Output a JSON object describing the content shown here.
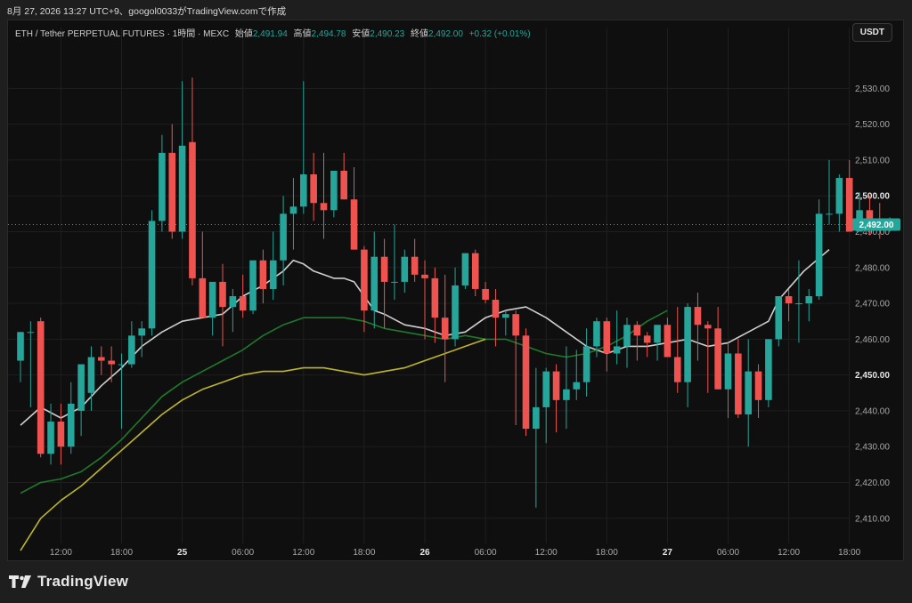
{
  "caption": "8月 27, 2026 13:27 UTC+9、googol0033がTradingView.comで作成",
  "legend": {
    "symbol": "ETH / Tether PERPETUAL FUTURES · 1時間 · MEXC",
    "open_label": "始値",
    "open": "2,491.94",
    "high_label": "高値",
    "high": "2,494.78",
    "low_label": "安値",
    "low": "2,490.23",
    "close_label": "終値",
    "close": "2,492.00",
    "change": "+0.32 (+0.01%)"
  },
  "unit_badge": "USDT",
  "footer": {
    "brand": "TradingView"
  },
  "colors": {
    "up": "#26a69a",
    "down": "#ef5350",
    "ma_fast": "#cfcfcf",
    "ma_mid": "#1e7a2a",
    "ma_slow": "#bdb52a",
    "grid": "#1f1f1f",
    "axis_text": "#a8a8a8",
    "price_badge_bg": "#26a69a",
    "price_badge_text": "#ffffff"
  },
  "chart_data": {
    "type": "candlestick",
    "interval": "1h",
    "y_range": [
      2403,
      2542
    ],
    "y_ticks": [
      {
        "value": 2410,
        "label": "2,410.00"
      },
      {
        "value": 2420,
        "label": "2,420.00"
      },
      {
        "value": 2430,
        "label": "2,430.00"
      },
      {
        "value": 2440,
        "label": "2,440.00"
      },
      {
        "value": 2450,
        "label": "2,450.00"
      },
      {
        "value": 2460,
        "label": "2,460.00"
      },
      {
        "value": 2470,
        "label": "2,470.00"
      },
      {
        "value": 2480,
        "label": "2,480.00"
      },
      {
        "value": 2490,
        "label": "2,490.00"
      },
      {
        "value": 2500,
        "label": "2,500.00"
      },
      {
        "value": 2510,
        "label": "2,510.00"
      },
      {
        "value": 2520,
        "label": "2,520.00"
      },
      {
        "value": 2530,
        "label": "2,530.00"
      }
    ],
    "bold_y_ticks": [
      2450,
      2500
    ],
    "x_ticks": [
      {
        "index": 4,
        "label": "12:00",
        "bold": false
      },
      {
        "index": 10,
        "label": "18:00",
        "bold": false
      },
      {
        "index": 16,
        "label": "25",
        "bold": true
      },
      {
        "index": 22,
        "label": "06:00",
        "bold": false
      },
      {
        "index": 28,
        "label": "12:00",
        "bold": false
      },
      {
        "index": 34,
        "label": "18:00",
        "bold": false
      },
      {
        "index": 40,
        "label": "26",
        "bold": true
      },
      {
        "index": 46,
        "label": "06:00",
        "bold": false
      },
      {
        "index": 52,
        "label": "12:00",
        "bold": false
      },
      {
        "index": 58,
        "label": "18:00",
        "bold": false
      },
      {
        "index": 64,
        "label": "27",
        "bold": true
      },
      {
        "index": 70,
        "label": "06:00",
        "bold": false
      },
      {
        "index": 76,
        "label": "12:00",
        "bold": false
      },
      {
        "index": 82,
        "label": "18:00",
        "bold": false
      }
    ],
    "last_price": {
      "value": 2492.0,
      "label": "2,492.00"
    },
    "candles": [
      [
        2454,
        2462,
        2448,
        2462
      ],
      [
        2462,
        2465,
        2441,
        2462
      ],
      [
        2465,
        2466,
        2427,
        2428
      ],
      [
        2428,
        2442,
        2425,
        2437
      ],
      [
        2437,
        2442,
        2425,
        2430
      ],
      [
        2430,
        2448,
        2428,
        2442
      ],
      [
        2440,
        2450,
        2433,
        2453
      ],
      [
        2445,
        2458,
        2440,
        2455
      ],
      [
        2455,
        2458,
        2450,
        2454
      ],
      [
        2454,
        2458,
        2448,
        2453
      ],
      [
        2453,
        2456,
        2435,
        2453
      ],
      [
        2453,
        2465,
        2452,
        2461
      ],
      [
        2461,
        2465,
        2455,
        2463
      ],
      [
        2463,
        2496,
        2461,
        2493
      ],
      [
        2493,
        2517,
        2490,
        2512
      ],
      [
        2512,
        2520,
        2488,
        2490
      ],
      [
        2490,
        2532,
        2488,
        2514
      ],
      [
        2515,
        2533,
        2475,
        2477
      ],
      [
        2477,
        2490,
        2475,
        2466
      ],
      [
        2466,
        2475,
        2461,
        2476
      ],
      [
        2476,
        2481,
        2458,
        2469
      ],
      [
        2469,
        2474,
        2462,
        2472
      ],
      [
        2472,
        2478,
        2466,
        2468
      ],
      [
        2468,
        2480,
        2467,
        2482
      ],
      [
        2482,
        2485,
        2470,
        2474
      ],
      [
        2474,
        2490,
        2471,
        2482
      ],
      [
        2482,
        2500,
        2475,
        2495
      ],
      [
        2495,
        2505,
        2485,
        2497
      ],
      [
        2497,
        2532,
        2495,
        2506
      ],
      [
        2506,
        2512,
        2493,
        2498
      ],
      [
        2498,
        2512,
        2488,
        2496
      ],
      [
        2496,
        2507,
        2494,
        2507
      ],
      [
        2507,
        2512,
        2499,
        2499
      ],
      [
        2499,
        2508,
        2485,
        2485
      ],
      [
        2485,
        2486,
        2462,
        2468
      ],
      [
        2468,
        2490,
        2463,
        2483
      ],
      [
        2483,
        2488,
        2463,
        2476
      ],
      [
        2476,
        2492,
        2471,
        2476
      ],
      [
        2476,
        2485,
        2473,
        2483
      ],
      [
        2483,
        2488,
        2476,
        2478
      ],
      [
        2478,
        2482,
        2460,
        2477
      ],
      [
        2477,
        2480,
        2459,
        2466
      ],
      [
        2466,
        2478,
        2448,
        2460
      ],
      [
        2460,
        2480,
        2458,
        2475
      ],
      [
        2475,
        2484,
        2474,
        2484
      ],
      [
        2484,
        2485,
        2472,
        2474
      ],
      [
        2474,
        2476,
        2470,
        2471
      ],
      [
        2471,
        2474,
        2458,
        2466
      ],
      [
        2466,
        2468,
        2461,
        2467
      ],
      [
        2467,
        2468,
        2436,
        2461
      ],
      [
        2461,
        2463,
        2433,
        2435
      ],
      [
        2435,
        2452,
        2413,
        2441
      ],
      [
        2441,
        2452,
        2431,
        2451
      ],
      [
        2451,
        2453,
        2434,
        2443
      ],
      [
        2443,
        2458,
        2435,
        2446
      ],
      [
        2446,
        2457,
        2443,
        2448
      ],
      [
        2448,
        2463,
        2444,
        2458
      ],
      [
        2458,
        2466,
        2455,
        2465
      ],
      [
        2465,
        2466,
        2451,
        2456
      ],
      [
        2456,
        2468,
        2453,
        2458
      ],
      [
        2458,
        2466,
        2452,
        2464
      ],
      [
        2464,
        2465,
        2454,
        2461
      ],
      [
        2461,
        2462,
        2455,
        2459
      ],
      [
        2459,
        2462,
        2454,
        2464
      ],
      [
        2464,
        2466,
        2455,
        2455
      ],
      [
        2455,
        2469,
        2445,
        2448
      ],
      [
        2448,
        2470,
        2441,
        2469
      ],
      [
        2469,
        2473,
        2454,
        2464
      ],
      [
        2464,
        2465,
        2445,
        2463
      ],
      [
        2463,
        2469,
        2446,
        2446
      ],
      [
        2446,
        2459,
        2438,
        2456
      ],
      [
        2456,
        2460,
        2438,
        2439
      ],
      [
        2439,
        2460,
        2430,
        2451
      ],
      [
        2451,
        2453,
        2438,
        2443
      ],
      [
        2443,
        2460,
        2441,
        2460
      ],
      [
        2460,
        2472,
        2458,
        2472
      ],
      [
        2472,
        2474,
        2465,
        2470
      ],
      [
        2470,
        2482,
        2459,
        2470
      ],
      [
        2470,
        2474,
        2465,
        2472
      ],
      [
        2472,
        2499,
        2471,
        2495
      ],
      [
        2495,
        2510,
        2492,
        2495
      ],
      [
        2495,
        2506,
        2490,
        2505
      ],
      [
        2505,
        2510,
        2494,
        2490
      ],
      [
        2490,
        2501,
        2492,
        2496
      ],
      [
        2496,
        2500,
        2489,
        2493
      ],
      [
        2493,
        2498,
        2488,
        2491
      ],
      [
        2491,
        2494,
        2490,
        2492
      ]
    ],
    "series": [
      {
        "name": "",
        "color_key": "ma_fast",
        "points": [
          [
            0,
            2436
          ],
          [
            4,
            2441
          ],
          [
            8,
            2438
          ],
          [
            12,
            2441
          ],
          [
            16,
            2447
          ],
          [
            20,
            2452
          ],
          [
            24,
            2458
          ],
          [
            28,
            2462
          ],
          [
            32,
            2465
          ],
          [
            36,
            2466
          ],
          [
            40,
            2467
          ],
          [
            44,
            2472
          ],
          [
            48,
            2475
          ],
          [
            52,
            2479
          ],
          [
            54,
            2482
          ],
          [
            56,
            2481
          ],
          [
            58,
            2479
          ],
          [
            60,
            2478
          ],
          [
            62,
            2477
          ],
          [
            64,
            2477
          ],
          [
            66,
            2476
          ],
          [
            68,
            2472
          ],
          [
            70,
            2468
          ],
          [
            72,
            2467
          ],
          [
            76,
            2464
          ],
          [
            80,
            2463
          ],
          [
            84,
            2461
          ],
          [
            88,
            2462
          ],
          [
            92,
            2466
          ],
          [
            96,
            2468
          ],
          [
            100,
            2469
          ],
          [
            104,
            2466
          ],
          [
            108,
            2462
          ],
          [
            112,
            2458
          ],
          [
            116,
            2456
          ],
          [
            120,
            2458
          ],
          [
            124,
            2458
          ],
          [
            128,
            2459
          ],
          [
            132,
            2460
          ],
          [
            136,
            2458
          ],
          [
            140,
            2459
          ],
          [
            144,
            2462
          ],
          [
            148,
            2465
          ],
          [
            150,
            2471
          ],
          [
            155,
            2479
          ],
          [
            160,
            2485
          ]
        ]
      },
      {
        "name": "",
        "color_key": "ma_mid",
        "points": [
          [
            0,
            2417
          ],
          [
            4,
            2420
          ],
          [
            8,
            2421
          ],
          [
            12,
            2423
          ],
          [
            16,
            2427
          ],
          [
            20,
            2432
          ],
          [
            24,
            2438
          ],
          [
            28,
            2444
          ],
          [
            32,
            2448
          ],
          [
            36,
            2451
          ],
          [
            40,
            2454
          ],
          [
            44,
            2457
          ],
          [
            48,
            2461
          ],
          [
            52,
            2464
          ],
          [
            56,
            2466
          ],
          [
            60,
            2466
          ],
          [
            64,
            2466
          ],
          [
            68,
            2465
          ],
          [
            72,
            2463
          ],
          [
            76,
            2462
          ],
          [
            80,
            2461
          ],
          [
            84,
            2460
          ],
          [
            88,
            2461
          ],
          [
            92,
            2460
          ],
          [
            96,
            2460
          ],
          [
            100,
            2458
          ],
          [
            104,
            2456
          ],
          [
            108,
            2455
          ],
          [
            112,
            2456
          ],
          [
            116,
            2458
          ],
          [
            120,
            2461
          ],
          [
            124,
            2465
          ],
          [
            128,
            2468
          ]
        ]
      },
      {
        "name": "",
        "color_key": "ma_slow",
        "points": [
          [
            0,
            2401
          ],
          [
            4,
            2410
          ],
          [
            8,
            2415
          ],
          [
            12,
            2419
          ],
          [
            16,
            2424
          ],
          [
            20,
            2429
          ],
          [
            24,
            2434
          ],
          [
            28,
            2439
          ],
          [
            32,
            2443
          ],
          [
            36,
            2446
          ],
          [
            40,
            2448
          ],
          [
            44,
            2450
          ],
          [
            48,
            2451
          ],
          [
            52,
            2451
          ],
          [
            56,
            2452
          ],
          [
            60,
            2452
          ],
          [
            64,
            2451
          ],
          [
            68,
            2450
          ],
          [
            72,
            2451
          ],
          [
            76,
            2452
          ],
          [
            80,
            2454
          ],
          [
            84,
            2456
          ],
          [
            88,
            2458
          ],
          [
            92,
            2460
          ]
        ]
      }
    ]
  }
}
